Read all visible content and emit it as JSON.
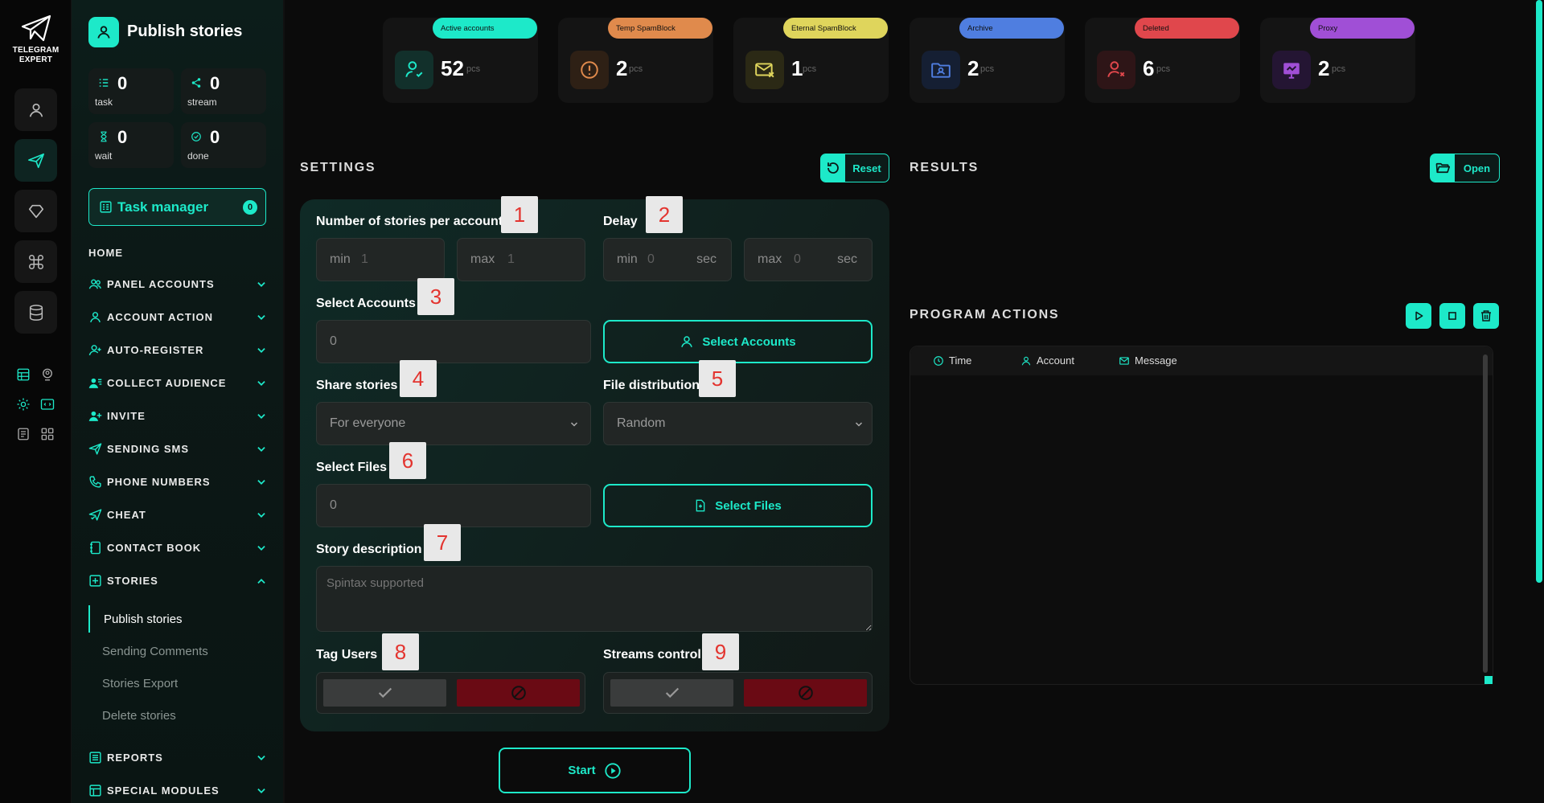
{
  "brand": {
    "name": "TELEGRAM EXPERT"
  },
  "page": {
    "title": "Publish stories"
  },
  "stats": [
    {
      "value": "0",
      "label": "task"
    },
    {
      "value": "0",
      "label": "stream"
    },
    {
      "value": "0",
      "label": "wait"
    },
    {
      "value": "0",
      "label": "done"
    }
  ],
  "task_manager": {
    "label": "Task manager",
    "count": "0"
  },
  "nav": {
    "home": "HOME",
    "items": [
      "PANEL ACCOUNTS",
      "ACCOUNT ACTION",
      "AUTO-REGISTER",
      "COLLECT AUDIENCE",
      "INVITE",
      "SENDING SMS",
      "PHONE NUMBERS",
      "CHEAT",
      "CONTACT BOOK",
      "STORIES",
      "REPORTS",
      "SPECIAL MODULES"
    ],
    "stories_sub": [
      "Publish stories",
      "Sending Comments",
      "Stories Export",
      "Delete stories"
    ]
  },
  "cards": [
    {
      "label": "Active accounts",
      "value": "52",
      "unit": "pcs",
      "color": "#1de9c9"
    },
    {
      "label": "Temp SpamBlock",
      "value": "2",
      "unit": "pcs",
      "color": "#e08a4c"
    },
    {
      "label": "Eternal SpamBlock",
      "value": "1",
      "unit": "pcs",
      "color": "#dfd55c"
    },
    {
      "label": "Archive",
      "value": "2",
      "unit": "pcs",
      "color": "#4f7ee0"
    },
    {
      "label": "Deleted",
      "value": "6",
      "unit": "pcs",
      "color": "#e0474c"
    },
    {
      "label": "Proxy",
      "value": "2",
      "unit": "pcs",
      "color": "#a04fd6"
    }
  ],
  "settings": {
    "title": "SETTINGS",
    "reset": "Reset",
    "stories_per_account": {
      "label": "Number of stories per account",
      "min_ph": "min",
      "min_val": "1",
      "max_ph": "max",
      "max_val": "1"
    },
    "delay": {
      "label": "Delay",
      "min_ph": "min",
      "min_val": "0",
      "max_ph": "max",
      "max_val": "0",
      "unit": "sec"
    },
    "select_accounts": {
      "label": "Select Accounts",
      "value": "0",
      "button": "Select Accounts"
    },
    "share_stories": {
      "label": "Share stories",
      "value": "For everyone"
    },
    "file_distribution": {
      "label": "File distribution",
      "value": "Random"
    },
    "select_files": {
      "label": "Select Files",
      "value": "0",
      "button": "Select Files"
    },
    "story_description": {
      "label": "Story description",
      "placeholder": "Spintax supported"
    },
    "tag_users": {
      "label": "Tag Users"
    },
    "streams_control": {
      "label": "Streams control"
    },
    "markers": [
      "1",
      "2",
      "3",
      "4",
      "5",
      "6",
      "7",
      "8",
      "9"
    ]
  },
  "results": {
    "title": "RESULTS",
    "open": "Open"
  },
  "program_actions": {
    "title": "PROGRAM ACTIONS",
    "columns": [
      "Time",
      "Account",
      "Message"
    ]
  },
  "start": {
    "label": "Start"
  },
  "colors": {
    "accent": "#1de9c9",
    "danger": "#6a0a14"
  }
}
